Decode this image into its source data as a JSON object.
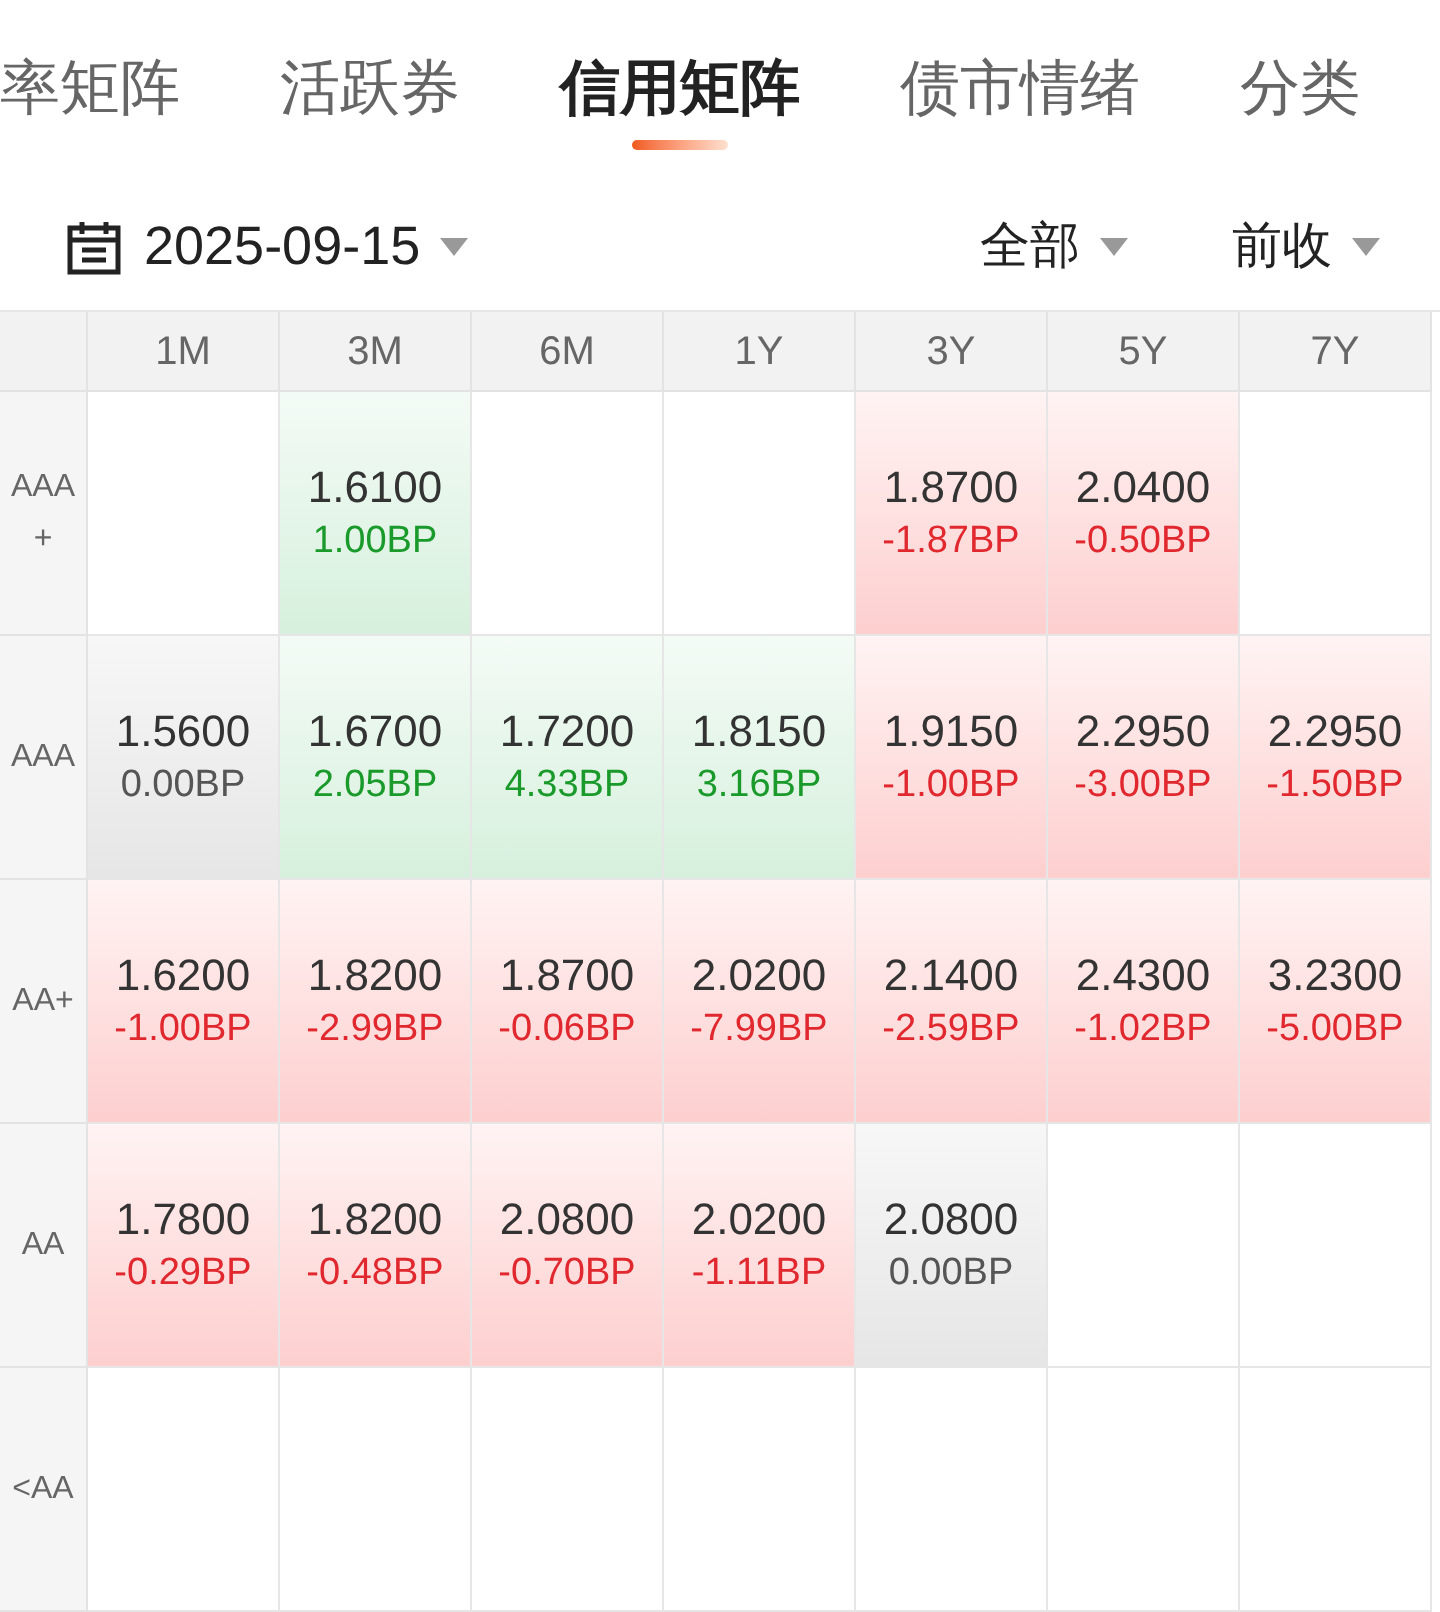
{
  "tabs": [
    {
      "label": "率矩阵",
      "selected": false
    },
    {
      "label": "活跃券",
      "selected": false
    },
    {
      "label": "信用矩阵",
      "selected": true
    },
    {
      "label": "债市情绪",
      "selected": false
    },
    {
      "label": "分类",
      "selected": false
    }
  ],
  "filters": {
    "date": "2025-09-15",
    "scope": "全部",
    "price": "前收"
  },
  "table": {
    "columns": [
      "1M",
      "3M",
      "6M",
      "1Y",
      "3Y",
      "5Y",
      "7Y"
    ],
    "rows": [
      {
        "label": "AAA+",
        "cells": [
          {
            "kind": "empty"
          },
          {
            "kind": "rise",
            "value": "1.6100",
            "change": "1.00BP"
          },
          {
            "kind": "empty"
          },
          {
            "kind": "empty"
          },
          {
            "kind": "fall",
            "value": "1.8700",
            "change": "-1.87BP"
          },
          {
            "kind": "fall",
            "value": "2.0400",
            "change": "-0.50BP"
          },
          {
            "kind": "empty"
          }
        ]
      },
      {
        "label": "AAA",
        "cells": [
          {
            "kind": "flat",
            "value": "1.5600",
            "change": "0.00BP"
          },
          {
            "kind": "rise",
            "value": "1.6700",
            "change": "2.05BP"
          },
          {
            "kind": "rise",
            "value": "1.7200",
            "change": "4.33BP"
          },
          {
            "kind": "rise",
            "value": "1.8150",
            "change": "3.16BP"
          },
          {
            "kind": "fall",
            "value": "1.9150",
            "change": "-1.00BP"
          },
          {
            "kind": "fall",
            "value": "2.2950",
            "change": "-3.00BP"
          },
          {
            "kind": "fall",
            "value": "2.2950",
            "change": "-1.50BP"
          }
        ]
      },
      {
        "label": "AA+",
        "cells": [
          {
            "kind": "fall",
            "value": "1.6200",
            "change": "-1.00BP"
          },
          {
            "kind": "fall",
            "value": "1.8200",
            "change": "-2.99BP"
          },
          {
            "kind": "fall",
            "value": "1.8700",
            "change": "-0.06BP"
          },
          {
            "kind": "fall",
            "value": "2.0200",
            "change": "-7.99BP"
          },
          {
            "kind": "fall",
            "value": "2.1400",
            "change": "-2.59BP"
          },
          {
            "kind": "fall",
            "value": "2.4300",
            "change": "-1.02BP"
          },
          {
            "kind": "fall",
            "value": "3.2300",
            "change": "-5.00BP"
          }
        ]
      },
      {
        "label": "AA",
        "cells": [
          {
            "kind": "fall",
            "value": "1.7800",
            "change": "-0.29BP"
          },
          {
            "kind": "fall",
            "value": "1.8200",
            "change": "-0.48BP"
          },
          {
            "kind": "fall",
            "value": "2.0800",
            "change": "-0.70BP"
          },
          {
            "kind": "fall",
            "value": "2.0200",
            "change": "-1.11BP"
          },
          {
            "kind": "flat",
            "value": "2.0800",
            "change": "0.00BP"
          },
          {
            "kind": "empty"
          },
          {
            "kind": "empty"
          }
        ]
      },
      {
        "label": "<AA",
        "cells": [
          {
            "kind": "empty"
          },
          {
            "kind": "empty"
          },
          {
            "kind": "empty"
          },
          {
            "kind": "empty"
          },
          {
            "kind": "empty"
          },
          {
            "kind": "empty"
          },
          {
            "kind": "empty"
          }
        ]
      }
    ]
  }
}
